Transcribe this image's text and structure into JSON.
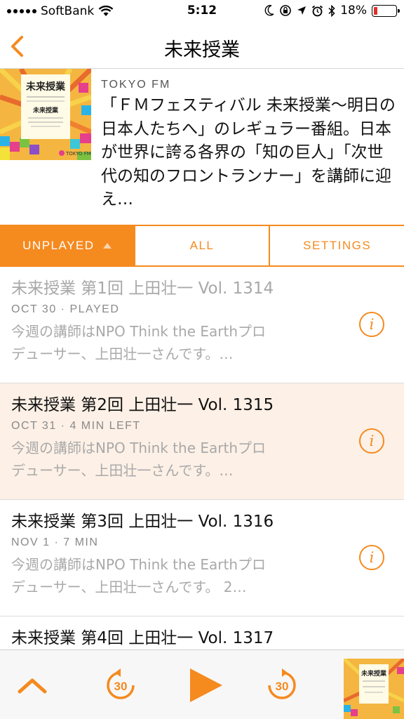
{
  "status_bar": {
    "carrier": "SoftBank",
    "time": "5:12",
    "battery": "18%",
    "battery_level": 0.18
  },
  "nav": {
    "title": "未来授業"
  },
  "podcast": {
    "network": "TOKYO FM",
    "description": "「ＦＭフェスティバル 未来授業〜明日の日本人たちへ」のレギュラー番組。日本が世界に誇る各界の「知の巨人」「次世代の知のフロントランナー」を講師に迎え…"
  },
  "segments": [
    {
      "label": "UNPLAYED"
    },
    {
      "label": "ALL"
    },
    {
      "label": "SETTINGS"
    }
  ],
  "episodes": [
    {
      "title": "未来授業 第1回 上田壮一 Vol. 1314",
      "meta": "OCT 30 · PLAYED",
      "desc_line1": "今週の講師はNPO Think the Earthプロ",
      "desc_line2": "デューサー、上田壮一さんです。…"
    },
    {
      "title": "未来授業 第2回 上田壮一 Vol. 1315",
      "meta": "OCT 31 · 4 MIN LEFT",
      "desc_line1": "今週の講師はNPO Think the Earthプロ",
      "desc_line2": "デューサー、上田壮一さんです。…"
    },
    {
      "title": "未来授業 第3回 上田壮一 Vol. 1316",
      "meta": "NOV 1 · 7 MIN",
      "desc_line1": "今週の講師はNPO Think the Earthプロ",
      "desc_line2": "デューサー、上田壮一さんです。 2…"
    },
    {
      "title": "未来授業 第4回 上田壮一 Vol. 1317",
      "meta": "",
      "desc_line1": "",
      "desc_line2": ""
    }
  ],
  "player": {
    "skip_back_seconds": "30",
    "skip_forward_seconds": "30"
  },
  "colors": {
    "accent": "#f58a1f",
    "in_progress_bg": "#fdf0e6",
    "played_text": "#a8a8a8"
  },
  "icons": [
    "back-chevron-icon",
    "wifi-icon",
    "moon-icon",
    "location-icon",
    "alarm-icon",
    "bluetooth-icon",
    "info-icon",
    "chevron-up-icon",
    "skip-back-30-icon",
    "play-icon",
    "skip-forward-30-icon"
  ]
}
